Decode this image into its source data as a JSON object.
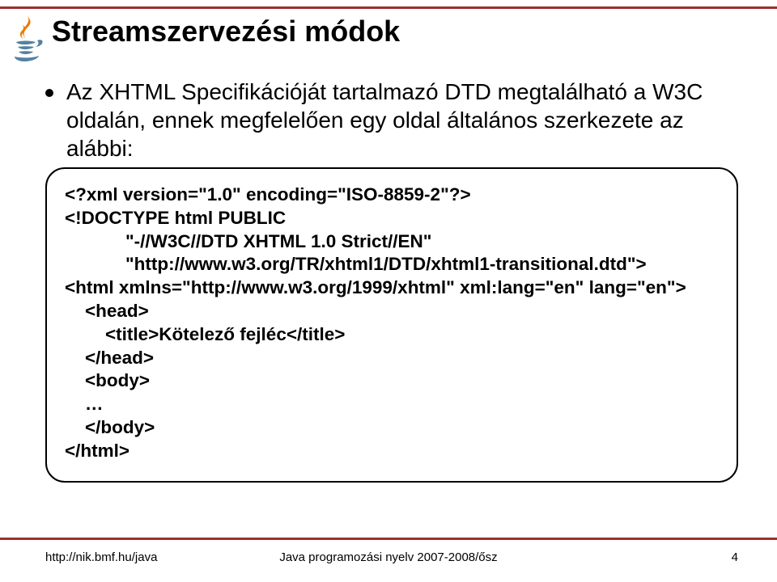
{
  "slide": {
    "title": "Streamszervezési módok",
    "bullet": "Az XHTML Specifikációját tartalmazó DTD megtalálható a W3C oldalán, ennek megfelelően egy oldal általános szerkezete az alábbi:",
    "code": "<?xml version=\"1.0\" encoding=\"ISO-8859-2\"?>\n<!DOCTYPE html PUBLIC\n            \"-//W3C//DTD XHTML 1.0 Strict//EN\"\n            \"http://www.w3.org/TR/xhtml1/DTD/xhtml1-transitional.dtd\">\n<html xmlns=\"http://www.w3.org/1999/xhtml\" xml:lang=\"en\" lang=\"en\">\n    <head>\n        <title>Kötelező fejléc</title>\n    </head>\n    <body>\n    …\n    </body>\n</html>"
  },
  "footer": {
    "left": "http://nik.bmf.hu/java",
    "center": "Java programozási nyelv 2007-2008/ősz",
    "right": "4"
  },
  "colors": {
    "accent": "#9c2f2f",
    "java_orange": "#ed7b00",
    "java_blue": "#5382a1"
  }
}
